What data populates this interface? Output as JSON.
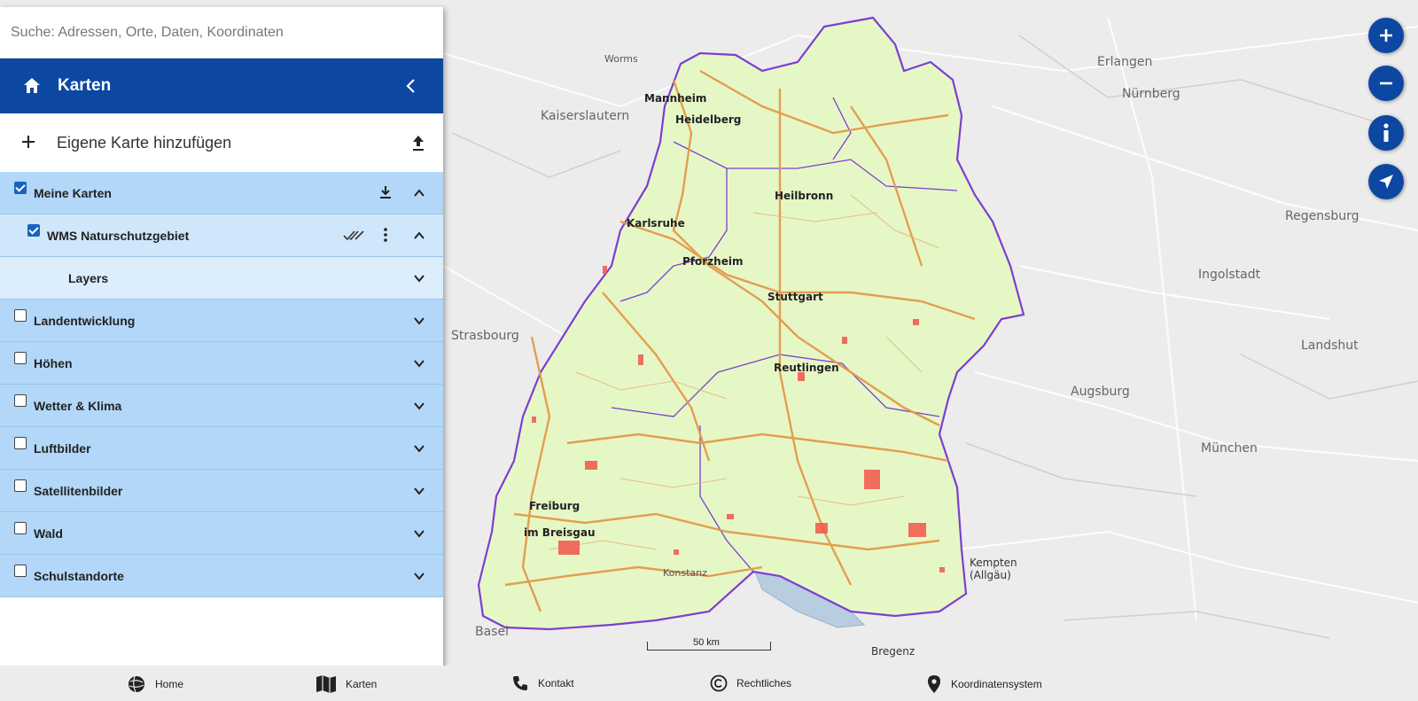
{
  "search": {
    "placeholder": "Suche: Adressen, Orte, Daten, Koordinaten"
  },
  "header": {
    "title": "Karten"
  },
  "add_map": {
    "label": "Eigene Karte hinzufügen"
  },
  "categories": [
    {
      "label": "Meine Karten",
      "checked": true
    },
    {
      "label": "WMS Naturschutzgebiet",
      "checked": true
    },
    {
      "label": "Layers"
    },
    {
      "label": "Landentwicklung",
      "checked": false
    },
    {
      "label": "Höhen",
      "checked": false
    },
    {
      "label": "Wetter & Klima",
      "checked": false
    },
    {
      "label": "Luftbilder",
      "checked": false
    },
    {
      "label": "Satellitenbilder",
      "checked": false
    },
    {
      "label": "Wald",
      "checked": false
    },
    {
      "label": "Schulstandorte",
      "checked": false
    }
  ],
  "map": {
    "scale_label": "50 km",
    "places": [
      "Mannheim",
      "Heidelberg",
      "Heilbronn",
      "Karlsruhe",
      "Pforzheim",
      "Stuttgart",
      "Reutlingen",
      "Freiburg",
      "im Breisgau",
      "Kaiserslautern",
      "Strasbourg",
      "Basel",
      "Erlangen",
      "Nürnberg",
      "Ingolstadt",
      "Augsburg",
      "München",
      "Regensburg",
      "Landshut",
      "Kempten",
      "(Allgäu)",
      "Bregenz",
      "Worms",
      "Konstanz"
    ],
    "colors": {
      "land_fill": "#e6f7c6",
      "border": "#7c3fd0",
      "roads": "#e39a4a",
      "reserves": "#f2564c",
      "base": "#ececec"
    }
  },
  "footer": {
    "home": "Home",
    "karten": "Karten",
    "kontakt": "Kontakt",
    "rechtliches": "Rechtliches",
    "koordinatensystem": "Koordinatensystem"
  }
}
